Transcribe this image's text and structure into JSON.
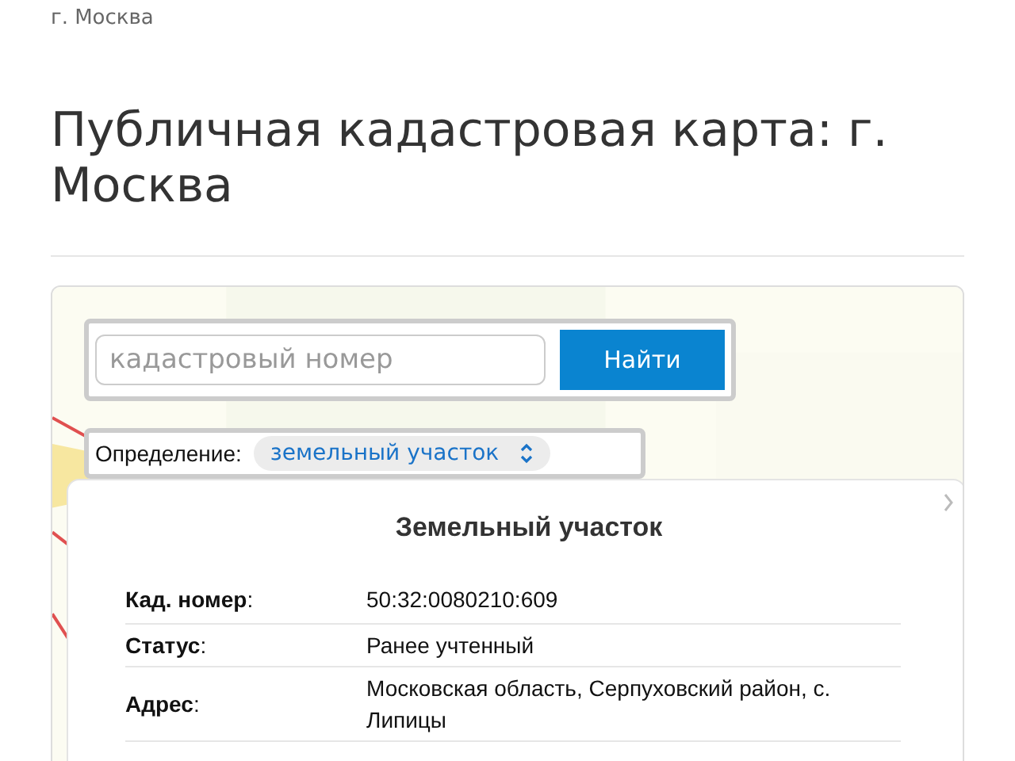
{
  "breadcrumb": "г. Москва",
  "title": "Публичная кадастровая карта: г. Москва",
  "search": {
    "placeholder": "кадастровый номер",
    "button": "Найти"
  },
  "definition": {
    "label": "Определение:",
    "value": "земельный участок"
  },
  "popup": {
    "title": "Земельный участок",
    "rows": [
      {
        "label": "**Кад. номер**:",
        "value": "50:32:0080210:609"
      },
      {
        "label": "**Статус**:",
        "value": "Ранее учтенный"
      },
      {
        "label": "**Адрес**:",
        "value": "Московская область, Серпуховский район, с. Липицы"
      }
    ]
  }
}
